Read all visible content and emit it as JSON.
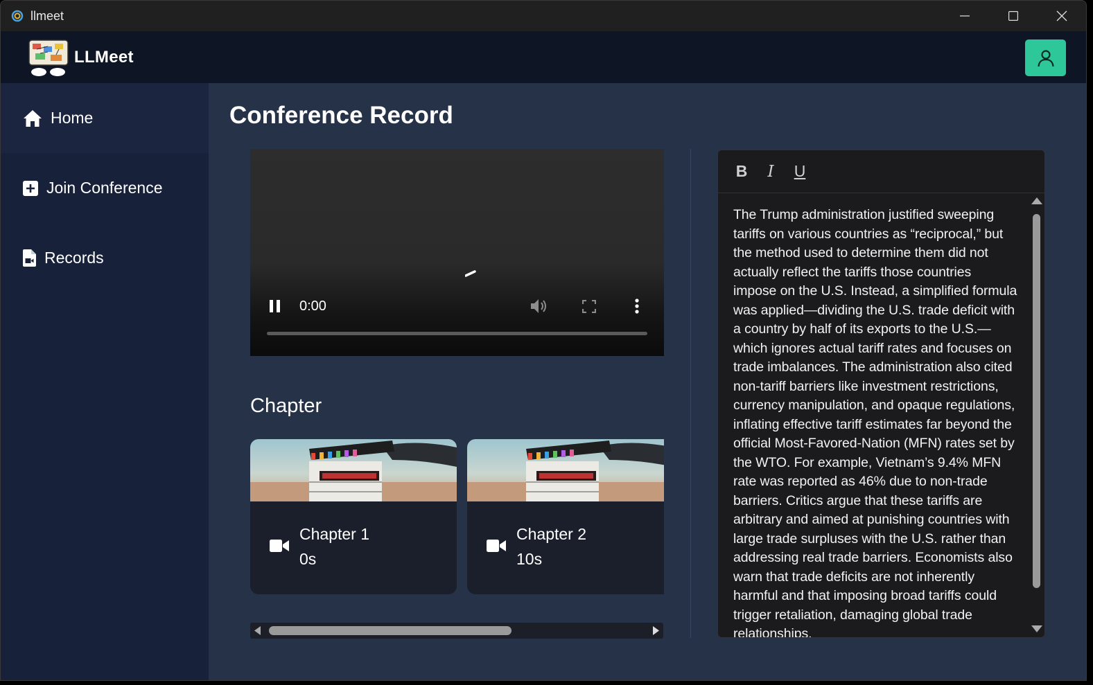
{
  "window": {
    "title": "llmeet"
  },
  "app": {
    "brand": "LLMeet"
  },
  "sidebar": {
    "items": [
      {
        "label": "Home",
        "icon": "home-icon"
      },
      {
        "label": "Join Conference",
        "icon": "plus-square-icon"
      },
      {
        "label": "Records",
        "icon": "video-file-icon"
      }
    ]
  },
  "page": {
    "title": "Conference Record"
  },
  "video": {
    "time": "0:00",
    "progress": 0
  },
  "chapters": {
    "heading": "Chapter",
    "items": [
      {
        "title": "Chapter 1",
        "time": "0s"
      },
      {
        "title": "Chapter 2",
        "time": "10s"
      }
    ]
  },
  "editor": {
    "toolbar": {
      "bold": "B",
      "italic": "I",
      "underline": "U"
    },
    "text": "The Trump administration justified sweeping tariffs on various countries as “reciprocal,” but the method used to determine them did not actually reflect the tariffs those countries impose on the U.S. Instead, a simplified formula was applied—dividing the U.S. trade deficit with a country by half of its exports to the U.S.—which ignores actual tariff rates and focuses on trade imbalances. The administration also cited non-tariff barriers like investment restrictions, currency manipulation, and opaque regulations, inflating effective tariff estimates far beyond the official Most-Favored-Nation (MFN) rates set by the WTO. For example, Vietnam’s 9.4% MFN rate was reported as 46% due to non-trade barriers. Critics argue that these tariffs are arbitrary and aimed at punishing countries with large trade surpluses with the U.S. rather than addressing real trade barriers. Economists also warn that trade deficits are not inherently harmful and that imposing broad tariffs could trigger retaliation, damaging global trade relationships."
  },
  "colors": {
    "accent": "#2ec79a",
    "sidebar": "#18213a",
    "main": "#263248",
    "header": "#0e1524"
  }
}
